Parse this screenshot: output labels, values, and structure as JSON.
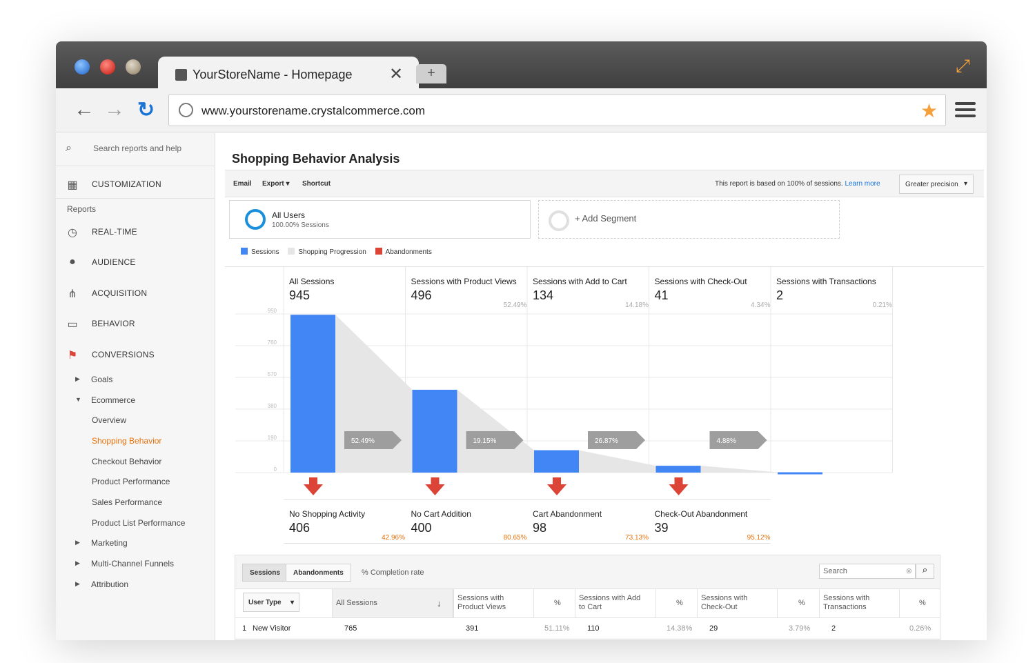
{
  "browser": {
    "tab_title": "YourStoreName - Homepage",
    "tab_close": "✕",
    "new_tab": "+",
    "url": "www.yourstorename.crystalcommerce.com"
  },
  "sidebar": {
    "search_placeholder": "Search reports and help",
    "customization": "CUSTOMIZATION",
    "reports_heading": "Reports",
    "sections": [
      "REAL-TIME",
      "AUDIENCE",
      "ACQUISITION",
      "BEHAVIOR",
      "CONVERSIONS"
    ],
    "conversions": {
      "goals": "Goals",
      "ecommerce": "Ecommerce",
      "ecommerce_items": [
        "Overview",
        "Shopping Behavior",
        "Checkout Behavior",
        "Product Performance",
        "Sales Performance",
        "Product List Performance"
      ],
      "active_item": "Shopping Behavior",
      "marketing": "Marketing",
      "multichannel": "Multi-Channel Funnels",
      "attribution": "Attribution"
    }
  },
  "report": {
    "title": "Shopping Behavior Analysis",
    "actions": [
      "Email",
      "Export",
      "Shortcut"
    ],
    "note_prefix": "This report is based on 100% of sessions.",
    "learn_more": "Learn more",
    "precision": "Greater precision"
  },
  "segments": {
    "primary_name": "All Users",
    "primary_sub": "100.00% Sessions",
    "add_label": "+ Add Segment"
  },
  "legend": [
    {
      "label": "Sessions",
      "color": "#4285f4"
    },
    {
      "label": "Shopping Progression",
      "color": "#e6e6e6"
    },
    {
      "label": "Abandonments",
      "color": "#db4437"
    }
  ],
  "chart_data": {
    "type": "bar",
    "ylim": [
      0,
      950
    ],
    "yticks": [
      0,
      190,
      380,
      570,
      760,
      950
    ],
    "categories": [
      "All Sessions",
      "Sessions with Product Views",
      "Sessions with Add to Cart",
      "Sessions with Check-Out",
      "Sessions with Transactions"
    ],
    "series": [
      {
        "name": "Sessions",
        "values": [
          945,
          496,
          134,
          41,
          2
        ]
      }
    ],
    "stage_pcts": [
      "",
      "52.49%",
      "14.18%",
      "4.34%",
      "0.21%"
    ],
    "progression_pcts": [
      "52.49%",
      "19.15%",
      "26.87%",
      "4.88%"
    ],
    "abandonments": [
      {
        "name": "No Shopping Activity",
        "value": 406,
        "pct": "42.96%"
      },
      {
        "name": "No Cart Addition",
        "value": 400,
        "pct": "80.65%"
      },
      {
        "name": "Cart Abandonment",
        "value": 98,
        "pct": "73.13%"
      },
      {
        "name": "Check-Out Abandonment",
        "value": 39,
        "pct": "95.12%"
      }
    ]
  },
  "table": {
    "tabs": [
      "Sessions",
      "Abandonments"
    ],
    "completion": "% Completion rate",
    "search_placeholder": "Search",
    "dimension": "User Type",
    "columns": [
      "All Sessions",
      "Sessions with\nProduct Views",
      "%",
      "Sessions with Add\nto Cart",
      "%",
      "Sessions with\nCheck-Out",
      "%",
      "Sessions with\nTransactions",
      "%"
    ],
    "rows": [
      {
        "index": "1",
        "label": "New Visitor",
        "cells": [
          "765",
          "391",
          "51.11%",
          "110",
          "14.38%",
          "29",
          "3.79%",
          "2",
          "0.26%"
        ]
      }
    ]
  },
  "colors": {
    "accent": "#4285f4",
    "abandon": "#db4437",
    "active_nav": "#e8710a",
    "brand_orange": "#f5a03b"
  }
}
